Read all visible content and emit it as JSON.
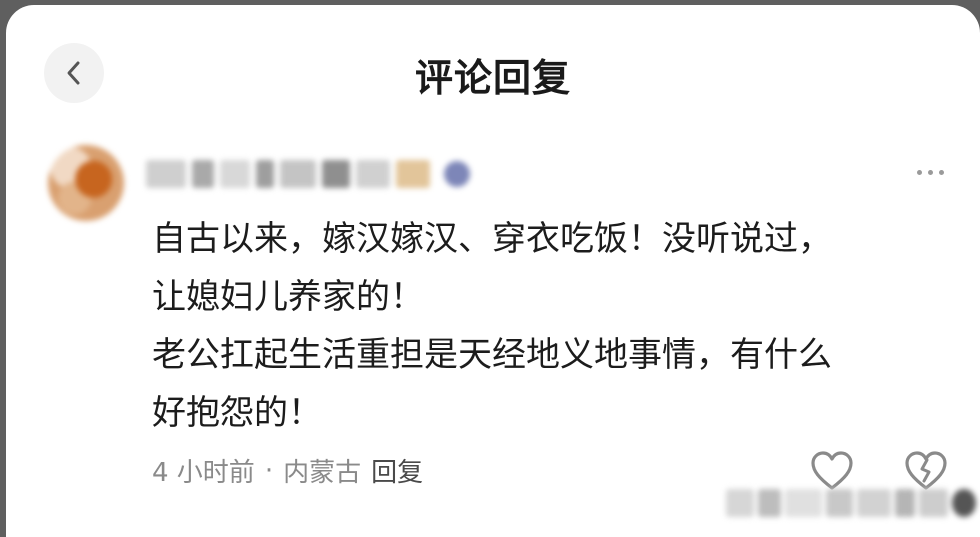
{
  "header": {
    "title": "评论回复",
    "back_icon": "chevron-left-icon"
  },
  "comment": {
    "author_name": "",
    "more_icon": "more-horizontal-icon",
    "lines": [
      "自古以来，嫁汉嫁汉、穿衣吃饭！没听说过，",
      "让媳妇儿养家的！",
      "老公扛起生活重担是天经地义地事情，有什么",
      "好抱怨的！"
    ],
    "time": "4 小时前",
    "separator": "·",
    "location": "内蒙古",
    "reply_label": "回复",
    "like_icon": "heart-icon",
    "dislike_icon": "broken-heart-icon"
  },
  "colors": {
    "text_primary": "#1c1c1c",
    "text_secondary": "#8a8a8a",
    "icon_gray": "#9a9a9a"
  }
}
